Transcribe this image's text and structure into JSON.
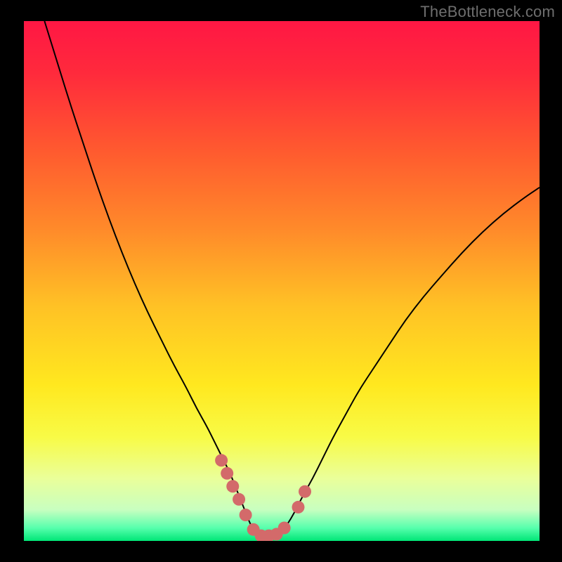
{
  "watermark": "TheBottleneck.com",
  "colors": {
    "frame": "#000000",
    "watermark_text": "#6e6e6e",
    "curve_stroke": "#000000",
    "marker_fill": "#d36a6a",
    "gradient_stops": [
      {
        "offset": 0.0,
        "color": "#ff1744"
      },
      {
        "offset": 0.1,
        "color": "#ff2a3c"
      },
      {
        "offset": 0.25,
        "color": "#ff5a2f"
      },
      {
        "offset": 0.4,
        "color": "#ff8a2a"
      },
      {
        "offset": 0.55,
        "color": "#ffc225"
      },
      {
        "offset": 0.7,
        "color": "#ffe81f"
      },
      {
        "offset": 0.8,
        "color": "#f8fb46"
      },
      {
        "offset": 0.88,
        "color": "#eaff9a"
      },
      {
        "offset": 0.94,
        "color": "#c8ffc0"
      },
      {
        "offset": 0.975,
        "color": "#57ffad"
      },
      {
        "offset": 1.0,
        "color": "#00e676"
      }
    ]
  },
  "chart_data": {
    "type": "line",
    "title": "",
    "xlabel": "",
    "ylabel": "",
    "xlim": [
      0,
      100
    ],
    "ylim": [
      0,
      100
    ],
    "grid": false,
    "series": [
      {
        "name": "bottleneck-curve",
        "x": [
          4,
          6.5,
          9,
          11.5,
          14,
          16.5,
          19,
          21.5,
          24,
          26.5,
          29,
          31.5,
          33.5,
          35.5,
          37,
          38.5,
          40,
          41,
          42,
          43,
          44,
          45,
          46.5,
          48,
          49.5,
          51,
          52.5,
          54,
          56,
          58,
          60,
          62.5,
          65,
          68,
          71,
          74,
          77.5,
          81,
          85,
          89,
          93,
          97,
          100
        ],
        "y": [
          100,
          92,
          84,
          76.5,
          69,
          62,
          55.5,
          49.5,
          44,
          39,
          34,
          29.5,
          25.5,
          22,
          19,
          16,
          13,
          10.5,
          8,
          5.5,
          3,
          1.5,
          1,
          1,
          1.5,
          3,
          5.5,
          8.5,
          12,
          16,
          20,
          24.5,
          29,
          33.5,
          38,
          42.5,
          47,
          51,
          55.5,
          59.5,
          63,
          66,
          68
        ]
      }
    ],
    "markers": {
      "name": "highlight-points",
      "x": [
        38.3,
        39.4,
        40.5,
        41.7,
        43.0,
        44.5,
        46.0,
        47.5,
        49.0,
        50.5,
        53.2,
        54.5
      ],
      "y": [
        15.5,
        13.0,
        10.5,
        8.0,
        5.0,
        2.2,
        1.0,
        1.0,
        1.3,
        2.5,
        6.5,
        9.5
      ]
    }
  }
}
